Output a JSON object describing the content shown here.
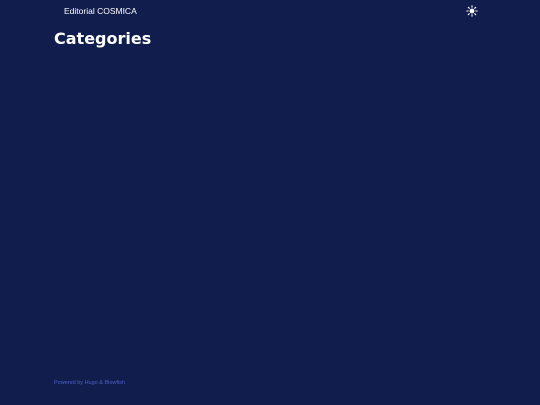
{
  "header": {
    "site_title": "Editorial COSMICA",
    "theme_toggle_icon": "sun-icon"
  },
  "main": {
    "page_title": "Categories"
  },
  "footer": {
    "powered_by_prefix": "Powered by ",
    "hugo_link": "Hugo",
    "separator": " & ",
    "theme_link": "Blowfish"
  },
  "colors": {
    "background": "#111d4c",
    "text": "#ffffff",
    "footer_link": "#4a62c9"
  }
}
